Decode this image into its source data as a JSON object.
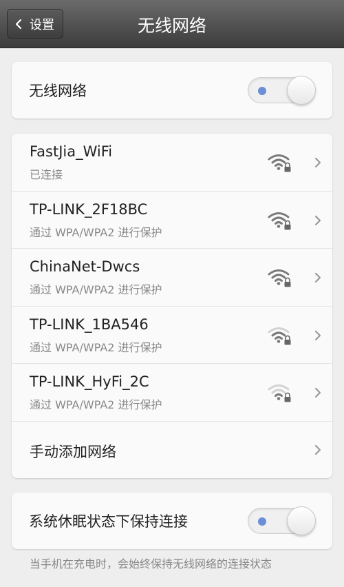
{
  "header": {
    "back_label": "设置",
    "title": "无线网络"
  },
  "wifi_toggle": {
    "label": "无线网络",
    "state": "on"
  },
  "networks": [
    {
      "name": "FastJia_WiFi",
      "status": "已连接",
      "signal": 4
    },
    {
      "name": "TP-LINK_2F18BC",
      "status": "通过 WPA/WPA2 进行保护",
      "signal": 4
    },
    {
      "name": "ChinaNet-Dwcs",
      "status": "通过 WPA/WPA2 进行保护",
      "signal": 4
    },
    {
      "name": "TP-LINK_1BA546",
      "status": "通过 WPA/WPA2 进行保护",
      "signal": 3
    },
    {
      "name": "TP-LINK_HyFi_2C",
      "status": "通过 WPA/WPA2 进行保护",
      "signal": 2
    }
  ],
  "add_network": {
    "label": "手动添加网络"
  },
  "sleep_toggle": {
    "label": "系统休眠状态下保持连接",
    "state": "on"
  },
  "footer": {
    "note": "当手机在充电时，会始终保持无线网络的连接状态"
  },
  "colors": {
    "toggle_dot": "#6b8ed8",
    "header_top": "#6a6a6a",
    "header_bottom": "#3c3c3c"
  },
  "icons": {
    "wifi": "wifi-lock-icon",
    "chevron": "chevron-right-icon",
    "back": "chevron-left-icon"
  }
}
